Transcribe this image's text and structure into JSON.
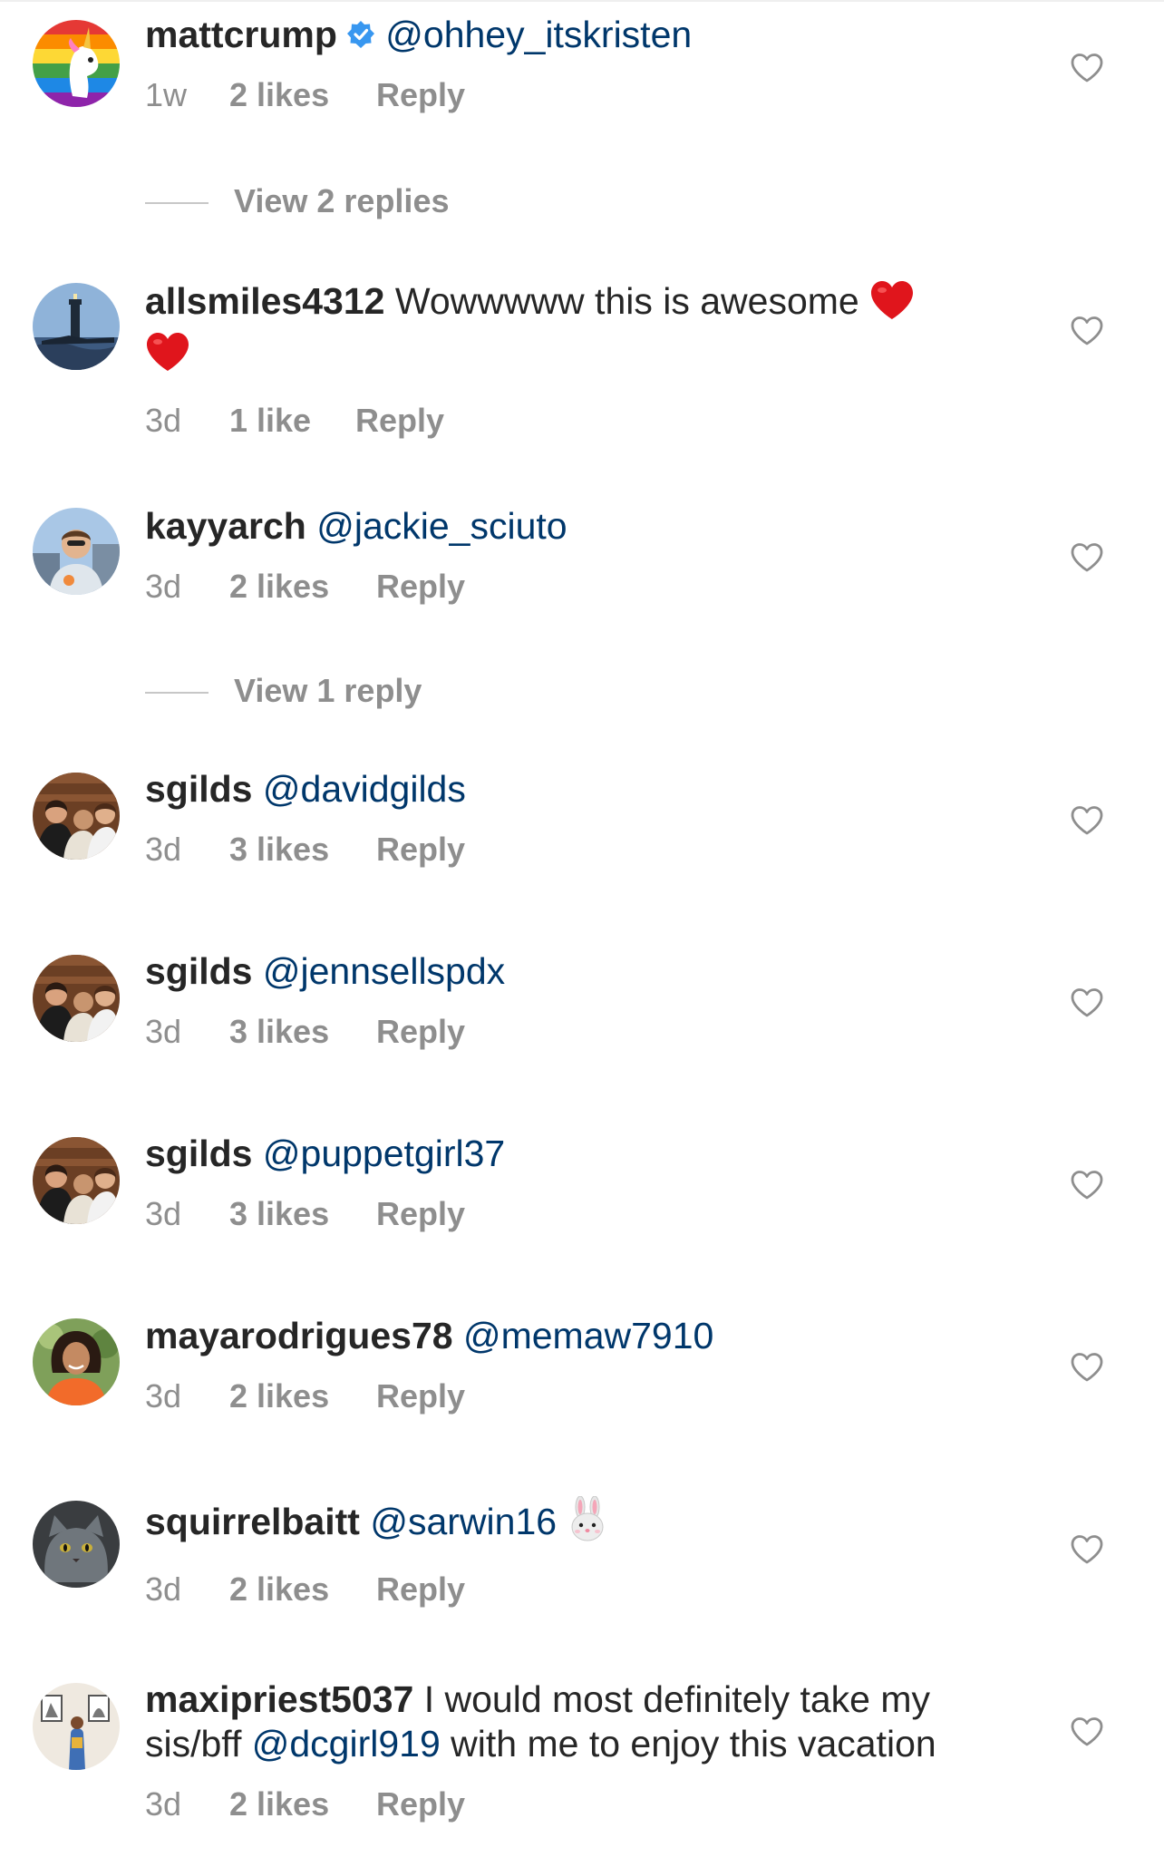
{
  "colors": {
    "text": "#262626",
    "secondary": "#8e8e8e",
    "mention": "#00376b",
    "verified": "#3897f0",
    "divider": "#c7c7c7",
    "heart_emoji": "#e0151c"
  },
  "comments": [
    {
      "username": "mattcrump",
      "verified": true,
      "mention": "@ohhey_itskristen",
      "time": "1w",
      "likes": "2 likes",
      "reply": "Reply",
      "view_replies": "View 2 replies",
      "avatar_icon": "unicorn-avatar-icon"
    },
    {
      "username": "allsmiles4312",
      "text": "Wowwwww this is awesome",
      "emoji": "red-heart-emoji",
      "time": "3d",
      "likes": "1 like",
      "reply": "Reply",
      "avatar_icon": "lighthouse-avatar-icon"
    },
    {
      "username": "kayyarch",
      "mention": "@jackie_sciuto",
      "time": "3d",
      "likes": "2 likes",
      "reply": "Reply",
      "view_replies": "View 1 reply",
      "avatar_icon": "person-avatar-icon"
    },
    {
      "username": "sgilds",
      "mention": "@davidgilds",
      "time": "3d",
      "likes": "3 likes",
      "reply": "Reply",
      "avatar_icon": "group-photo-avatar-icon"
    },
    {
      "username": "sgilds",
      "mention": "@jennsellspdx",
      "time": "3d",
      "likes": "3 likes",
      "reply": "Reply",
      "avatar_icon": "group-photo-avatar-icon"
    },
    {
      "username": "sgilds",
      "mention": "@puppetgirl37",
      "time": "3d",
      "likes": "3 likes",
      "reply": "Reply",
      "avatar_icon": "group-photo-avatar-icon"
    },
    {
      "username": "mayarodrigues78",
      "mention": "@memaw7910",
      "time": "3d",
      "likes": "2 likes",
      "reply": "Reply",
      "avatar_icon": "woman-avatar-icon"
    },
    {
      "username": "squirrelbaitt",
      "mention": "@sarwin16",
      "emoji": "rabbit-face-emoji",
      "time": "3d",
      "likes": "2 likes",
      "reply": "Reply",
      "avatar_icon": "gray-cat-avatar-icon"
    },
    {
      "username": "maxipriest5037",
      "text_before": "I would most definitely take my",
      "text_line2": "sis/bff",
      "mention": "@dcgirl919",
      "text_after": "with me to enjoy this vacation",
      "time": "3d",
      "likes": "2 likes",
      "reply": "Reply",
      "avatar_icon": "artwork-room-avatar-icon"
    }
  ]
}
